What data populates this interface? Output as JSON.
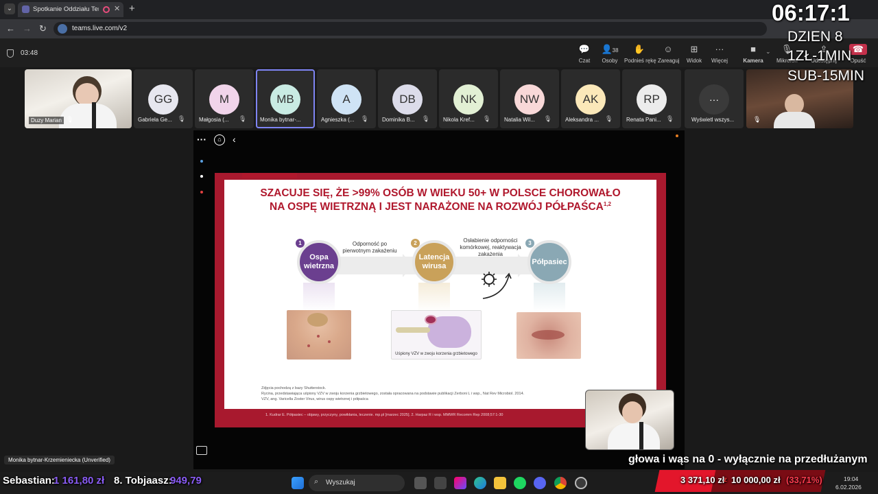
{
  "browser": {
    "tab_title": "Spotkanie Oddziału Tereno",
    "url": "teams.live.com/v2"
  },
  "meeting": {
    "elapsed": "03:48",
    "toolbar": {
      "chat": "Czat",
      "people": "Osoby",
      "people_count": "38",
      "raise_hand": "Podnieś rękę",
      "react": "Zareaguj",
      "view": "Widok",
      "more": "Więcej",
      "camera": "Kamera",
      "mic": "Mikrofon",
      "share": "Udostępnij",
      "leave": "Opuść"
    },
    "participants": [
      {
        "name": "Duzy Marian",
        "initials": "",
        "color": ""
      },
      {
        "name": "Gabriela Ge...",
        "initials": "GG",
        "color": "#e7e7ef"
      },
      {
        "name": "Małgosia (...",
        "initials": "M",
        "color": "#f1d4ea"
      },
      {
        "name": "Monika bytnar-...",
        "initials": "MB",
        "color": "#c9ebe3"
      },
      {
        "name": "Agnieszka (...",
        "initials": "A",
        "color": "#cfe3f5"
      },
      {
        "name": "Dominika B...",
        "initials": "DB",
        "color": "#dcdcea"
      },
      {
        "name": "Nikola Kref...",
        "initials": "NK",
        "color": "#e2f0d4"
      },
      {
        "name": "Natalia Wil...",
        "initials": "NW",
        "color": "#f8d8d8"
      },
      {
        "name": "Aleksandra ...",
        "initials": "AK",
        "color": "#fbe8b9"
      },
      {
        "name": "Renata Pani...",
        "initials": "RP",
        "color": "#ececec"
      },
      {
        "name": "Wyświetl wszys...",
        "initials": "···",
        "color": "#3a3a3a"
      }
    ],
    "presenter_label": "Monika bytnar-Krzemieniecka (Unverified)"
  },
  "overlay": {
    "clock": "06:17:1",
    "day": "DZIEN 8",
    "rate": "1ZŁ-1MIN",
    "sub": "SUB-15MIN",
    "ticker": "głowa i wąs na 0 - wyłącznie na przedłużanym",
    "donor1_label": "Sebastian:",
    "donor1_value": "1 161,80 zł",
    "donor2_label": "8. Tobjaasz:",
    "donor2_value": "949,79",
    "goal_current": "3 371,10 zł",
    "goal_sep": "z",
    "goal_target": "10 000,00 zł",
    "goal_pct": "(33,71%)",
    "goal_progress": 0.3371
  },
  "slide": {
    "title_line1": "SZACUJE SIĘ, ŻE >99% OSÓB W WIEKU 50+ W POLSCE CHOROWAŁO",
    "title_line2": "NA OSPĘ WIETRZNĄ I JEST NARAŻONE NA ROZWÓJ PÓŁPAŚCA",
    "title_sup": "1,2",
    "steps": [
      {
        "num": "1",
        "label": "Ospa wietrzna",
        "color": "#6b3f8f"
      },
      {
        "num": "2",
        "label": "Latencja wirusa",
        "color": "#c9a15a"
      },
      {
        "num": "3",
        "label": "Półpasiec",
        "color": "#8aa8b4"
      }
    ],
    "arrow1_text": "Odporność po pierwotnym zakażeniu",
    "arrow2_text": "Osłabienie odporności komórkowej, reaktywacja zakażenia",
    "diagram_caption": "Uśpiony VZV w zwoju korzenia grzbietowego",
    "footnote1": "Zdjęcia pochodzą z bazy Shutterstock.",
    "footnote2": "Rycina, przedstawiająca uśpiony VZV w zwoju korzenia grzbietowego, została opracowana na podstawie publikacji Zerboni L i wsp., Nat Rev Microbiol. 2014.",
    "footnote3": "VZV, ang. Varicella Zoster Virus, wirus ospy wietrznej i półpaśca",
    "references": "1. Kudrar E. Półpasiec – objawy, przyczyny, powikłania, leczenie. mp.pl [marzec 2025]. 2. Harpaz R i wsp. MMWR Recomm Rep 2008;57:1-30"
  },
  "taskbar": {
    "search": "Wyszukaj",
    "time": "19:04",
    "date": "6.02.2026"
  }
}
